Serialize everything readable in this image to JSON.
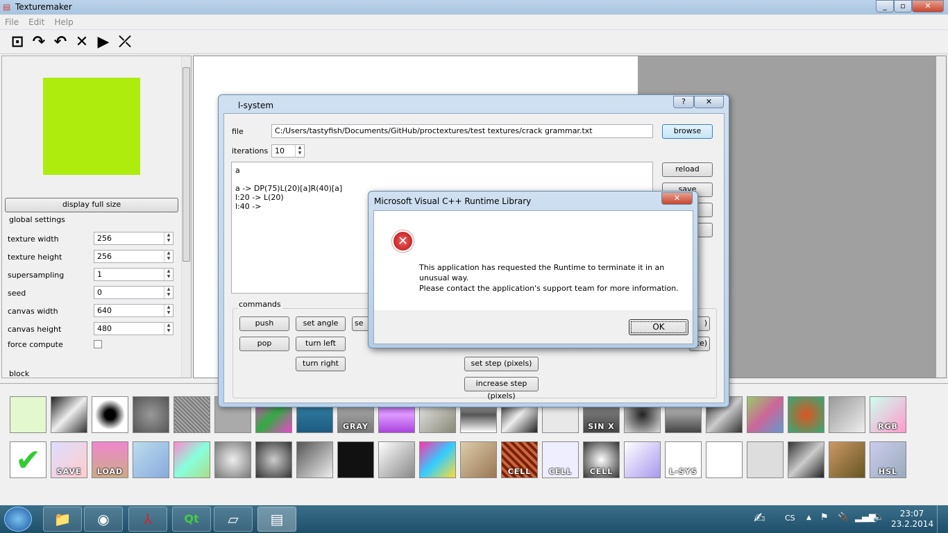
{
  "app": {
    "title": "Texturemaker",
    "menu": [
      "File",
      "Edit",
      "Help"
    ],
    "window_controls": [
      "minimize",
      "maximize",
      "close"
    ]
  },
  "toolbar": {
    "icons": [
      "save-icon",
      "redo-icon",
      "undo-icon",
      "delete-icon",
      "run-icon",
      "split-icon"
    ]
  },
  "left_panel": {
    "preview_color": "#aeec0e",
    "display_full_size": "display full size",
    "global_settings": "global settings",
    "fields": [
      {
        "label": "texture width",
        "value": "256"
      },
      {
        "label": "texture height",
        "value": "256"
      },
      {
        "label": "supersampling",
        "value": "1"
      },
      {
        "label": "seed",
        "value": "0"
      },
      {
        "label": "canvas width",
        "value": "640"
      },
      {
        "label": "canvas height",
        "value": "480"
      }
    ],
    "force_compute": "force compute",
    "block": "block"
  },
  "lsystem": {
    "title": "l-system",
    "help": "?",
    "file_label": "file",
    "file_value": "C:/Users/tastyfish/Documents/GitHub/proctextures/test textures/crack grammar.txt",
    "browse": "browse",
    "iterations_label": "iterations",
    "iterations_value": "10",
    "reload": "reload",
    "save": "save",
    "grammar": [
      "a",
      "",
      "a -> DP(75)L(20)[a]R(40)[a]",
      "l:20 -> L(20)",
      "l:40 ->"
    ],
    "commands_label": "commands",
    "commands": {
      "push": "push",
      "set_angle": "set angle",
      "set_partial": "se",
      "pop": "pop",
      "turn_left": "turn left",
      "turn_right": "turn right",
      "set_step": "set step (pixels)",
      "increase_step": "increase step (pixels)",
      "right_partial_1": ")",
      "right_partial_2": "te)"
    }
  },
  "error_dialog": {
    "title": "Microsoft Visual C++ Runtime Library",
    "message_line1": "This application has requested the Runtime to terminate it in an",
    "message_line2": "unusual way.",
    "message_line3": "Please contact the application's support team for more information.",
    "ok": "OK",
    "icon": "error-icon"
  },
  "tiles_row1": [
    {
      "l": ""
    },
    {
      "l": ""
    },
    {
      "l": ""
    },
    {
      "l": ""
    },
    {
      "l": ""
    },
    {
      "l": ""
    },
    {
      "l": ""
    },
    {
      "l": ""
    },
    {
      "l": "GRAY"
    },
    {
      "l": ""
    },
    {
      "l": ""
    },
    {
      "l": ""
    },
    {
      "l": ""
    },
    {
      "l": ""
    },
    {
      "l": "SIN X"
    },
    {
      "l": ""
    },
    {
      "l": ""
    },
    {
      "l": ""
    },
    {
      "l": ""
    },
    {
      "l": ""
    },
    {
      "l": ""
    },
    {
      "l": "RGB"
    }
  ],
  "tiles_row2": [
    {
      "l": ""
    },
    {
      "l": "SAVE"
    },
    {
      "l": "LOAD"
    },
    {
      "l": ""
    },
    {
      "l": ""
    },
    {
      "l": ""
    },
    {
      "l": ""
    },
    {
      "l": ""
    },
    {
      "l": ""
    },
    {
      "l": ""
    },
    {
      "l": ""
    },
    {
      "l": ""
    },
    {
      "l": "CELL"
    },
    {
      "l": "CELL"
    },
    {
      "l": "CELL"
    },
    {
      "l": ""
    },
    {
      "l": "L-SYS"
    },
    {
      "l": ""
    },
    {
      "l": ""
    },
    {
      "l": ""
    },
    {
      "l": ""
    },
    {
      "l": "HSL"
    }
  ],
  "taskbar": {
    "lang": "CS",
    "time": "23:07",
    "date": "23.2.2014"
  }
}
